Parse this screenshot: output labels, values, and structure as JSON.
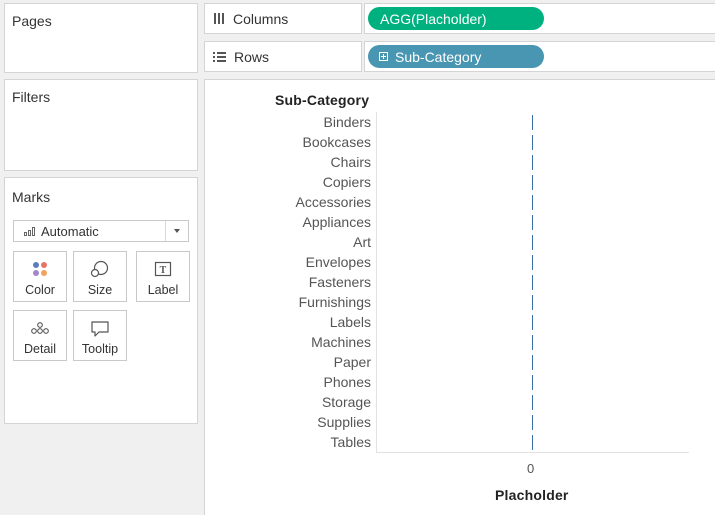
{
  "pages": {
    "title": "Pages"
  },
  "filters": {
    "title": "Filters"
  },
  "marks": {
    "title": "Marks",
    "type_value": "Automatic",
    "buttons": [
      {
        "label": "Color",
        "icon": "color-dots-icon"
      },
      {
        "label": "Size",
        "icon": "size-shapes-icon"
      },
      {
        "label": "Label",
        "icon": "text-label-icon"
      },
      {
        "label": "Detail",
        "icon": "detail-dots-icon"
      },
      {
        "label": "Tooltip",
        "icon": "speech-bubble-icon"
      }
    ]
  },
  "shelves": {
    "columns": {
      "label": "Columns",
      "icon": "columns-icon",
      "pill": "AGG(Placholder)",
      "pill_color": "#00b180"
    },
    "rows": {
      "label": "Rows",
      "icon": "rows-icon",
      "pill": "Sub-Category",
      "pill_color": "#4996b2"
    }
  },
  "chart_data": {
    "type": "bar",
    "row_header": "Sub-Category",
    "categories": [
      "Binders",
      "Bookcases",
      "Chairs",
      "Copiers",
      "Accessories",
      "Appliances",
      "Art",
      "Envelopes",
      "Fasteners",
      "Furnishings",
      "Labels",
      "Machines",
      "Paper",
      "Phones",
      "Storage",
      "Supplies",
      "Tables"
    ],
    "values": [
      0,
      0,
      0,
      0,
      0,
      0,
      0,
      0,
      0,
      0,
      0,
      0,
      0,
      0,
      0,
      0,
      0
    ],
    "x_ticks": [
      "0"
    ],
    "xlabel": "Placholder",
    "bar_color": "#3b6ea5"
  }
}
